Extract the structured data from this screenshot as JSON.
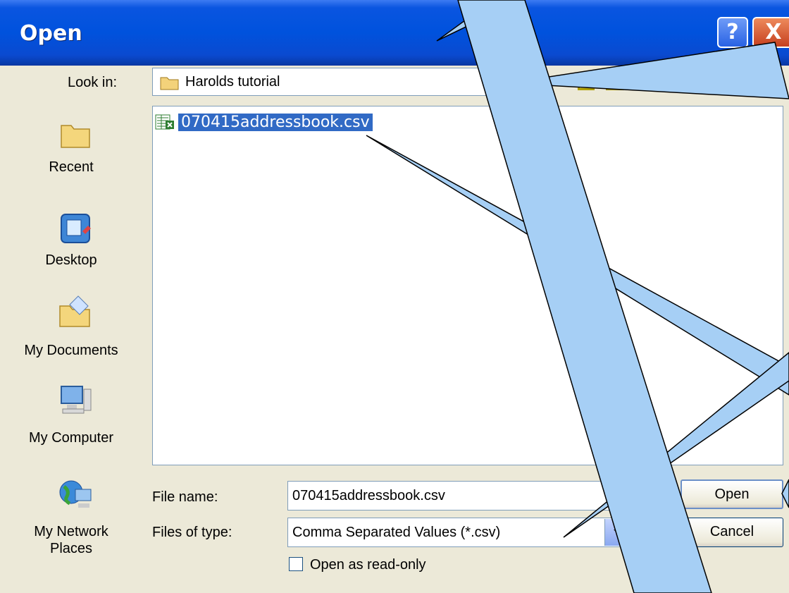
{
  "dialog": {
    "title": "Open"
  },
  "look_in": {
    "label": "Look in:",
    "value": "Harolds tutorial"
  },
  "places": [
    {
      "label": "Recent"
    },
    {
      "label": "Desktop"
    },
    {
      "label": "My Documents"
    },
    {
      "label": "My Computer"
    },
    {
      "label": "My Network Places"
    }
  ],
  "files": [
    {
      "name": "070415addressbook.csv",
      "selected": true
    }
  ],
  "file_name": {
    "label": "File name:",
    "value": "070415addressbook.csv"
  },
  "file_type": {
    "label": "Files of type:",
    "value": "Comma Separated Values (*.csv)"
  },
  "read_only": {
    "label": "Open as read-only",
    "checked": false
  },
  "buttons": {
    "open": "Open",
    "cancel": "Cancel",
    "help": "?",
    "close": "X"
  },
  "colors": {
    "titlebar": "#0052dd",
    "selection": "#316ac5",
    "callout_fill": "#a6cff5"
  }
}
